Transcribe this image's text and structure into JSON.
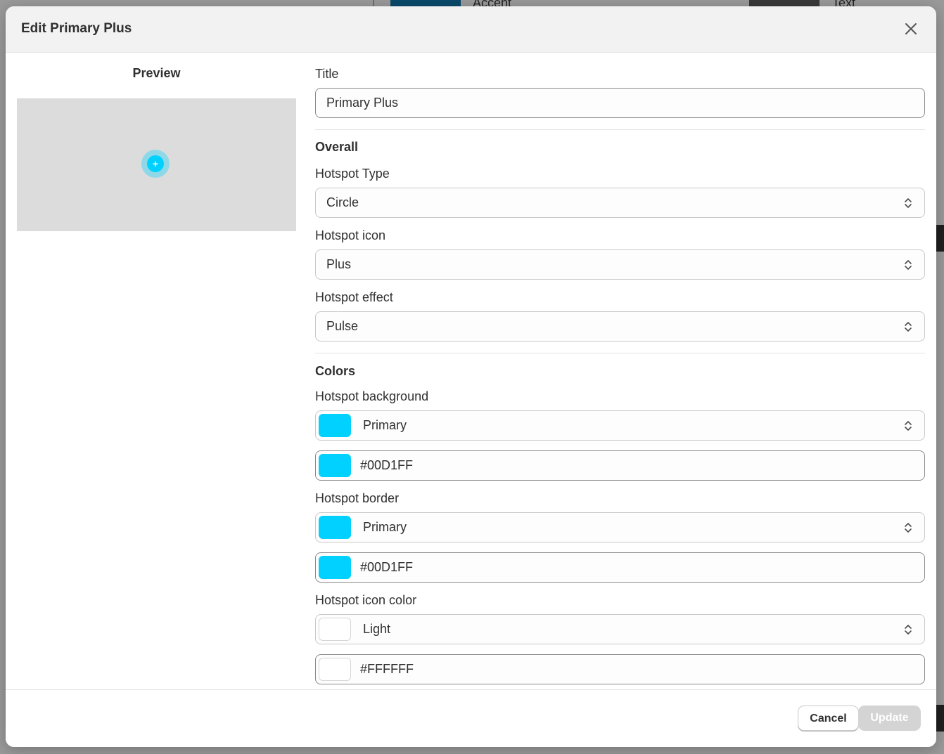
{
  "background": {
    "tab_accent": "Accent",
    "tab_text": "Text"
  },
  "modal": {
    "title": "Edit Primary Plus",
    "close_icon": "close-icon"
  },
  "preview": {
    "heading": "Preview",
    "hotspot_icon": "+",
    "hotspot_color": "#00D1FF"
  },
  "form": {
    "title_label": "Title",
    "title_value": "Primary Plus",
    "overall_heading": "Overall",
    "hotspot_type_label": "Hotspot Type",
    "hotspot_type_value": "Circle",
    "hotspot_icon_label": "Hotspot icon",
    "hotspot_icon_value": "Plus",
    "hotspot_effect_label": "Hotspot effect",
    "hotspot_effect_value": "Pulse",
    "colors_heading": "Colors",
    "hotspot_background": {
      "label": "Hotspot background",
      "preset": "Primary",
      "hex": "#00D1FF",
      "swatch_color": "#00D1FF"
    },
    "hotspot_border": {
      "label": "Hotspot border",
      "preset": "Primary",
      "hex": "#00D1FF",
      "swatch_color": "#00D1FF"
    },
    "hotspot_icon_color": {
      "label": "Hotspot icon color",
      "preset": "Light",
      "hex": "#FFFFFF",
      "swatch_color": "#FFFFFF"
    }
  },
  "footer": {
    "cancel_label": "Cancel",
    "update_label": "Update"
  }
}
